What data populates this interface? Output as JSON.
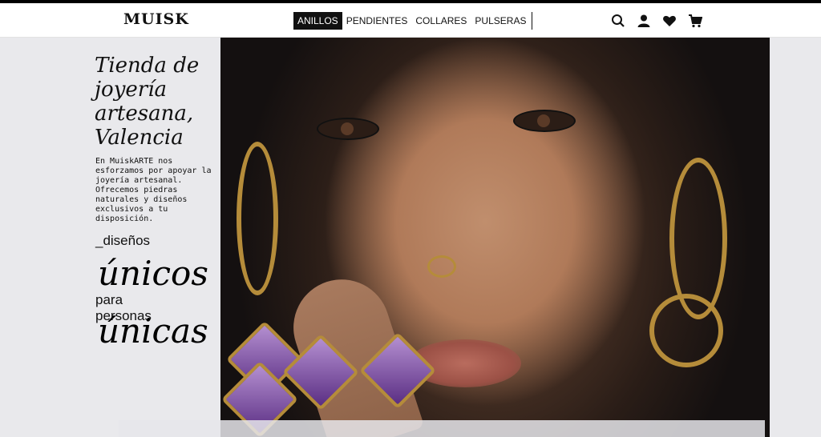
{
  "brand": {
    "logo_text": "MUISK"
  },
  "nav": {
    "items": [
      {
        "label": "ANILLOS",
        "active": true
      },
      {
        "label": "PENDIENTES",
        "active": false
      },
      {
        "label": "COLLARES",
        "active": false
      },
      {
        "label": "PULSERAS",
        "active": false
      }
    ]
  },
  "header_icons": [
    "search-icon",
    "user-icon",
    "heart-icon",
    "cart-icon"
  ],
  "hero": {
    "heading": "Tienda de joyería artesana, Valencia",
    "intro": "En MuiskARTE nos esforzamos por apoyar la joyería artesanal. Ofrecemos piedras naturales y diseños exclusivos a tu disposición.",
    "line1": "_diseños",
    "word1": "únicos",
    "line2": "para personas",
    "word2": "únicas"
  },
  "colors": {
    "accent": "#111111",
    "background": "#e9e9ec",
    "gold": "#b58c3a",
    "amethyst": "#6b3a98"
  }
}
